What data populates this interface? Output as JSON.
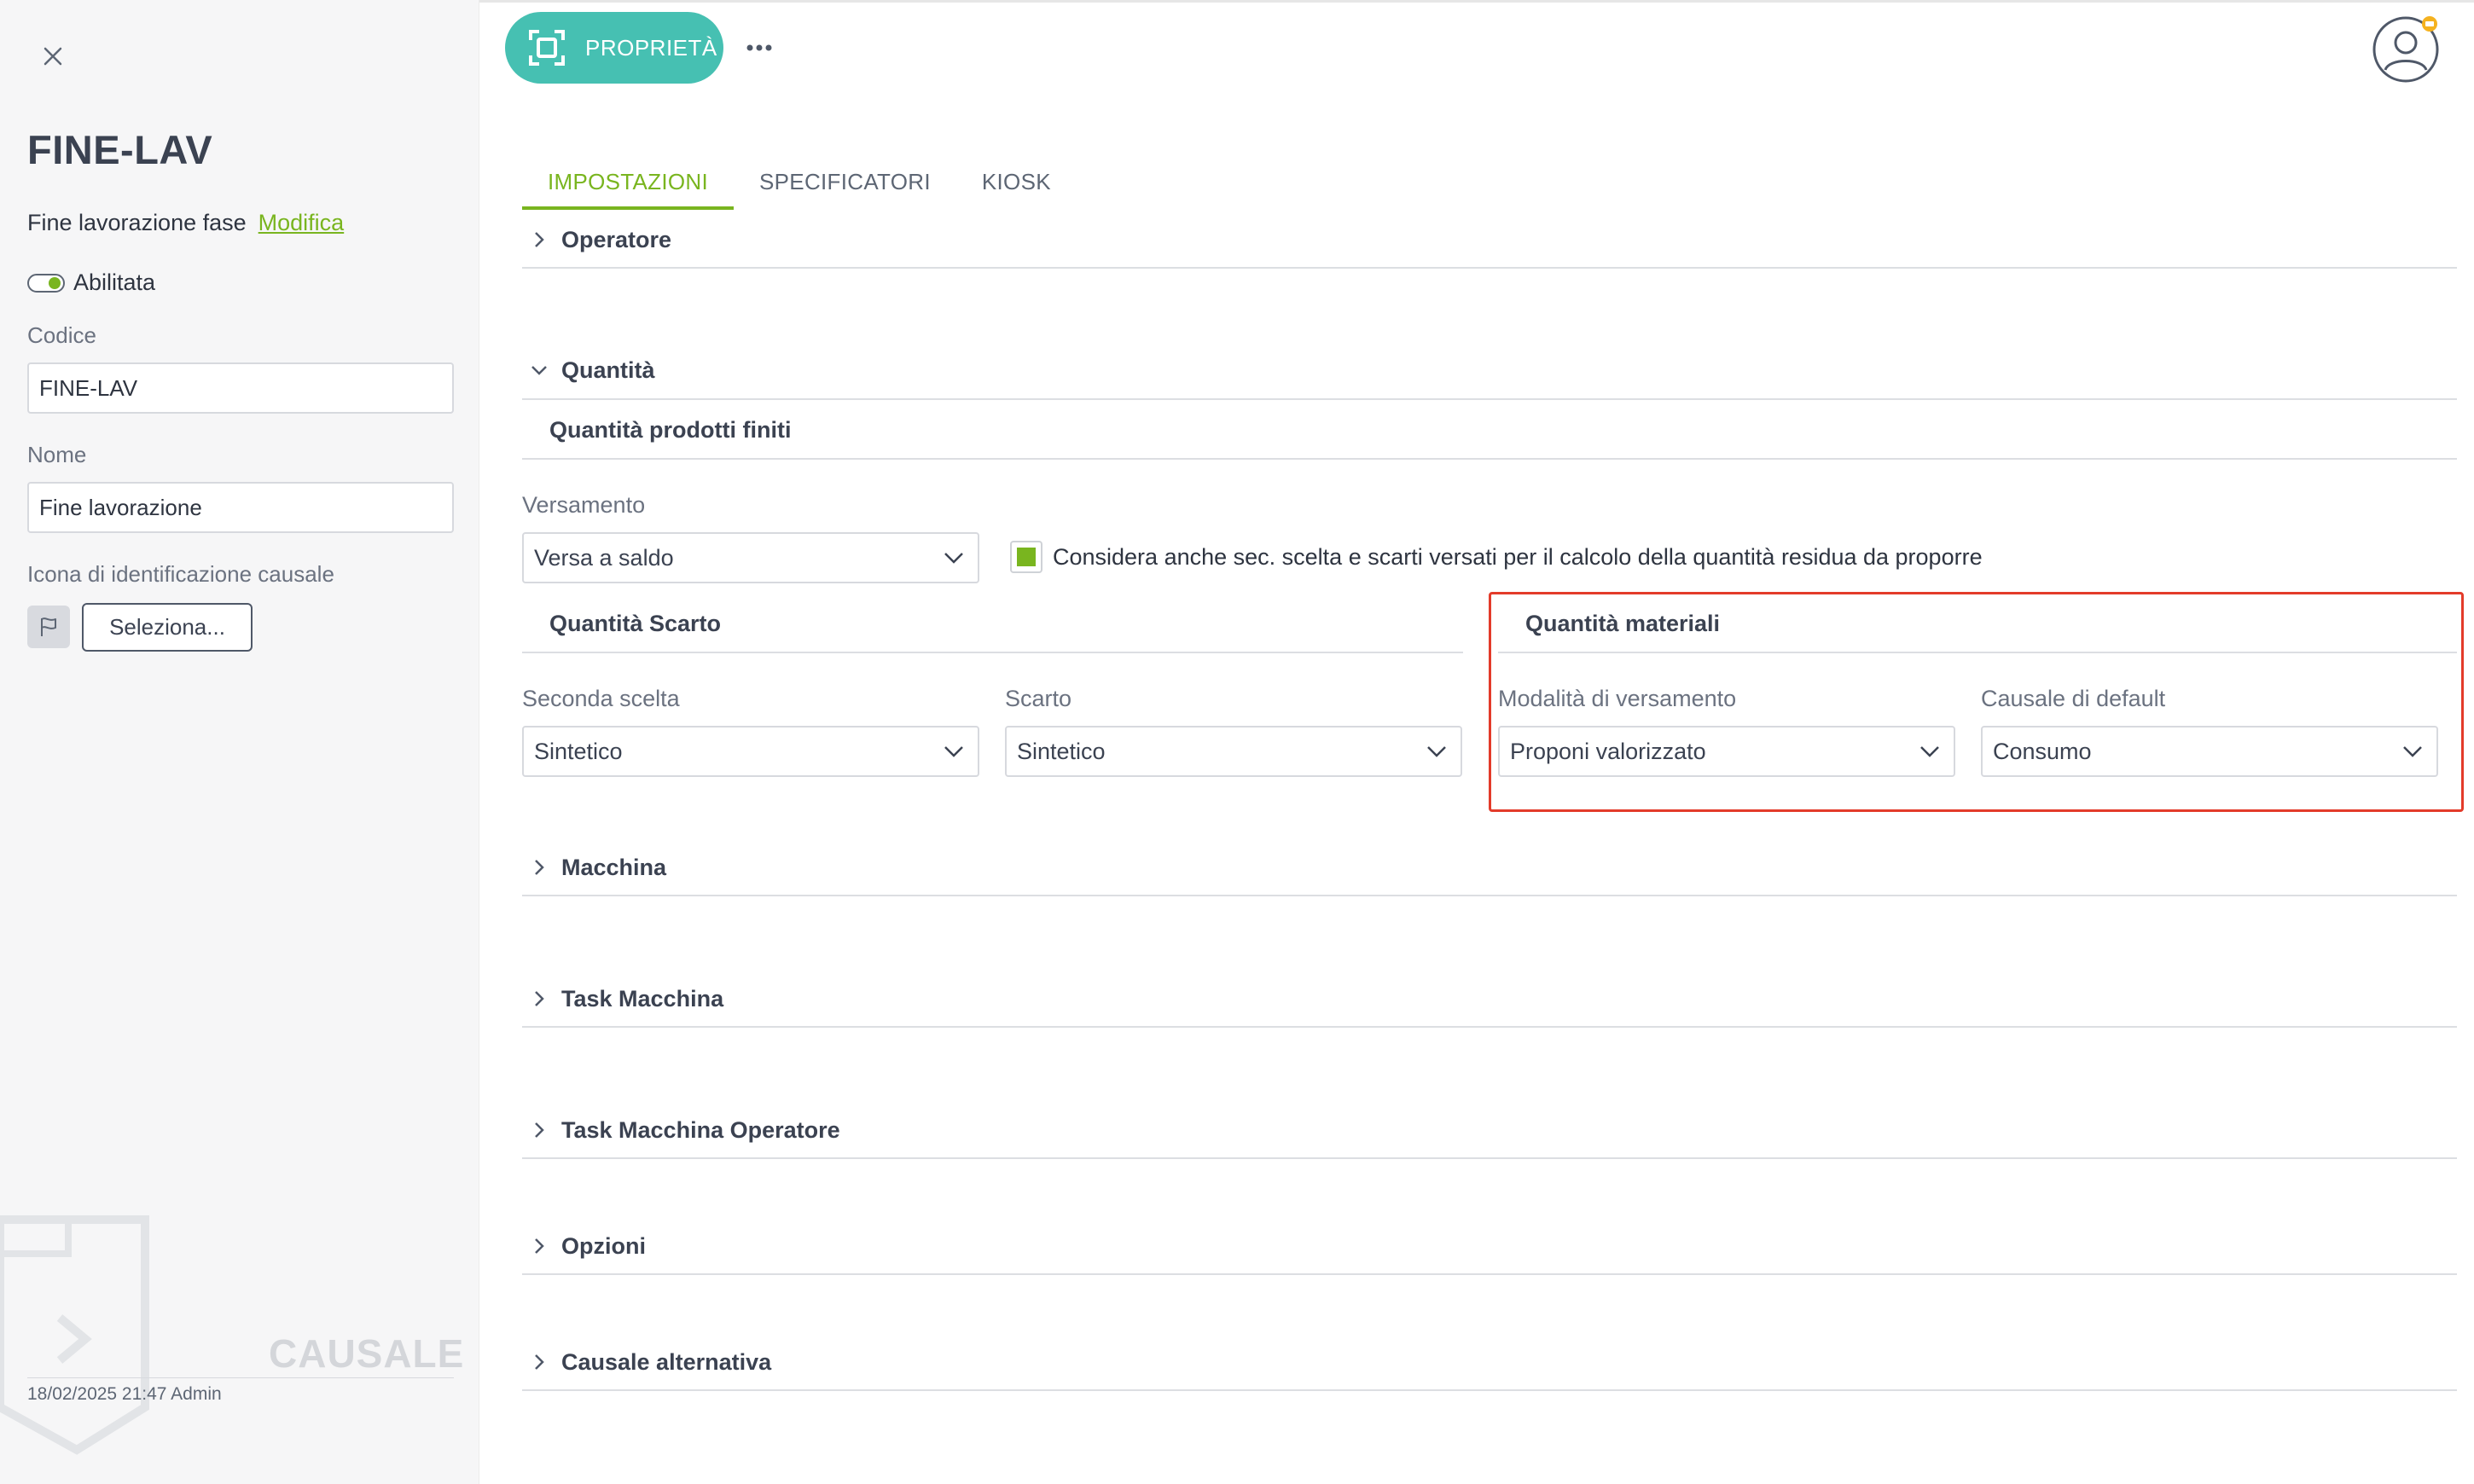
{
  "sidebar": {
    "title": "FINE-LAV",
    "description": "Fine lavorazione fase",
    "edit_link": "Modifica",
    "toggle_label": "Abilitata",
    "code_label": "Codice",
    "code_value": "FINE-LAV",
    "name_label": "Nome",
    "name_value": "Fine lavorazione",
    "icon_label": "Icona di identificazione causale",
    "select_button": "Seleziona...",
    "watermark": "CAUSALE",
    "footer": "18/02/2025 21:47 Admin"
  },
  "header": {
    "properties_button": "PROPRIETÀ"
  },
  "tabs": [
    {
      "label": "IMPOSTAZIONI",
      "active": true
    },
    {
      "label": "SPECIFICATORI",
      "active": false
    },
    {
      "label": "KIOSK",
      "active": false
    }
  ],
  "sections": {
    "operatore": "Operatore",
    "quantita": "Quantità",
    "macchina": "Macchina",
    "task_macchina": "Task Macchina",
    "task_macchina_operatore": "Task Macchina Operatore",
    "opzioni": "Opzioni",
    "causale_alternativa": "Causale alternativa"
  },
  "quantita": {
    "prodotti_finiti_title": "Quantità prodotti finiti",
    "versamento_label": "Versamento",
    "versamento_value": "Versa a saldo",
    "checkbox_label": "Considera anche sec. scelta e scarti versati per il calcolo della quantità residua da proporre",
    "checkbox_checked": true,
    "scarto_title": "Quantità Scarto",
    "seconda_scelta_label": "Seconda scelta",
    "seconda_scelta_value": "Sintetico",
    "scarto_label": "Scarto",
    "scarto_value": "Sintetico",
    "materiali_title": "Quantità materiali",
    "modalita_label": "Modalità di versamento",
    "modalita_value": "Proponi valorizzato",
    "causale_default_label": "Causale di default",
    "causale_default_value": "Consumo"
  },
  "colors": {
    "accent_green": "#79b51f",
    "teal_button": "#46c0b2",
    "highlight_red": "#e33b2a"
  },
  "icons": [
    "close-icon",
    "scan-icon",
    "more-icon",
    "user-icon",
    "flag-icon",
    "chevron-right-icon",
    "chevron-down-icon"
  ]
}
